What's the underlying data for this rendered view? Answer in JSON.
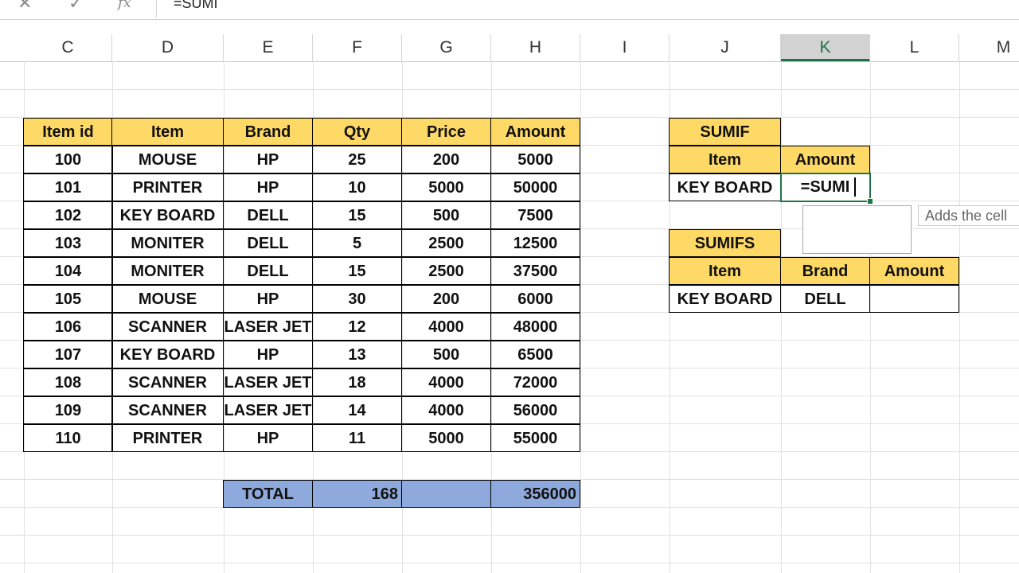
{
  "formula_bar": {
    "cancel_icon": "close-icon",
    "enter_icon": "check-icon",
    "fx_label": "fx",
    "formula_text": "=SUMI"
  },
  "columns": [
    "C",
    "D",
    "E",
    "F",
    "G",
    "H",
    "I",
    "J",
    "K",
    "L",
    "M"
  ],
  "active_column": "K",
  "main_table": {
    "headers": [
      "Item id",
      "Item",
      "Brand",
      "Qty",
      "Price",
      "Amount"
    ],
    "rows": [
      [
        "100",
        "MOUSE",
        "HP",
        "25",
        "200",
        "5000"
      ],
      [
        "101",
        "PRINTER",
        "HP",
        "10",
        "5000",
        "50000"
      ],
      [
        "102",
        "KEY BOARD",
        "DELL",
        "15",
        "500",
        "7500"
      ],
      [
        "103",
        "MONITER",
        "DELL",
        "5",
        "2500",
        "12500"
      ],
      [
        "104",
        "MONITER",
        "DELL",
        "15",
        "2500",
        "37500"
      ],
      [
        "105",
        "MOUSE",
        "HP",
        "30",
        "200",
        "6000"
      ],
      [
        "106",
        "SCANNER",
        "LASER JET",
        "12",
        "4000",
        "48000"
      ],
      [
        "107",
        "KEY BOARD",
        "HP",
        "13",
        "500",
        "6500"
      ],
      [
        "108",
        "SCANNER",
        "LASER JET",
        "18",
        "4000",
        "72000"
      ],
      [
        "109",
        "SCANNER",
        "LASER JET",
        "14",
        "4000",
        "56000"
      ],
      [
        "110",
        "PRINTER",
        "HP",
        "11",
        "5000",
        "55000"
      ]
    ],
    "total_label": "TOTAL",
    "total_qty": "168",
    "total_amount": "356000"
  },
  "sumif_table": {
    "title": "SUMIF",
    "headers": [
      "Item",
      "Amount"
    ],
    "item": "KEY BOARD",
    "amount_input": "=SUMI"
  },
  "sumifs_table": {
    "title": "SUMIFS",
    "headers": [
      "Item",
      "Brand",
      "Amount"
    ],
    "item": "KEY BOARD",
    "brand": "DELL",
    "amount": ""
  },
  "tooltip": {
    "text": "Adds the cell"
  },
  "colors": {
    "header_fill": "#ffd966",
    "total_fill": "#8ea9db",
    "active_cell_border": "#217346"
  }
}
